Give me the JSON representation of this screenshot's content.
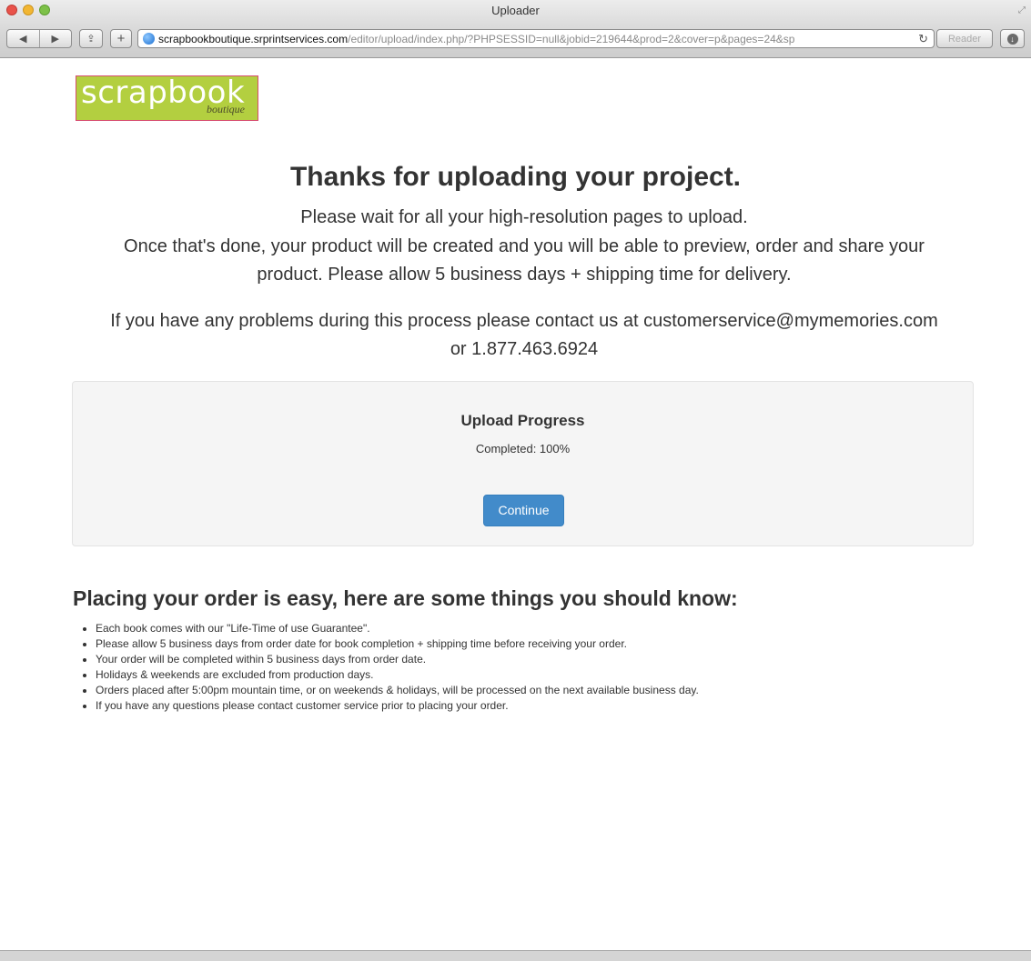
{
  "window": {
    "title": "Uploader",
    "url_domain": "scrapbookboutique.srprintservices.com",
    "url_path": "/editor/upload/index.php/?PHPSESSID=null&jobid=219644&prod=2&cover=p&pages=24&sp",
    "back_icon": "◀",
    "forward_icon": "▶",
    "share_icon": "⇪",
    "add_icon": "+",
    "reload_icon": "↻",
    "reader_label": "Reader",
    "download_icon": "↓",
    "resize_icon": "⤢"
  },
  "logo": {
    "main": "scrapbook",
    "sub": "boutique"
  },
  "intro": {
    "headline": "Thanks for uploading your project.",
    "line1": "Please wait for all your high-resolution pages to upload.",
    "line2": "Once that's done, your product will be created and you will be able to preview, order and share your",
    "line3": "product. Please allow 5 business days + shipping time for delivery.",
    "contact_line1": "If you have any problems during this process please contact us at customerservice@mymemories.com",
    "contact_line2": "or 1.877.463.6924"
  },
  "progress": {
    "title": "Upload Progress",
    "status": "Completed: 100%",
    "percent": 100,
    "button_label": "Continue"
  },
  "order": {
    "heading": "Placing your order is easy, here are some things you should know:",
    "tips": [
      "Each book comes with our \"Life-Time of use Guarantee\".",
      "Please allow 5 business days from order date for book completion + shipping time before receiving your order.",
      "Your order will be completed within 5 business days from order date.",
      "Holidays & weekends are excluded from production days.",
      "Orders placed after 5:00pm mountain time, or on weekends & holidays, will be processed on the next available business day.",
      "If you have any questions please contact customer service prior to placing your order."
    ]
  },
  "colors": {
    "accent": "#428bca",
    "logo_bg": "#b3cf40",
    "logo_border": "#d64c6f"
  }
}
